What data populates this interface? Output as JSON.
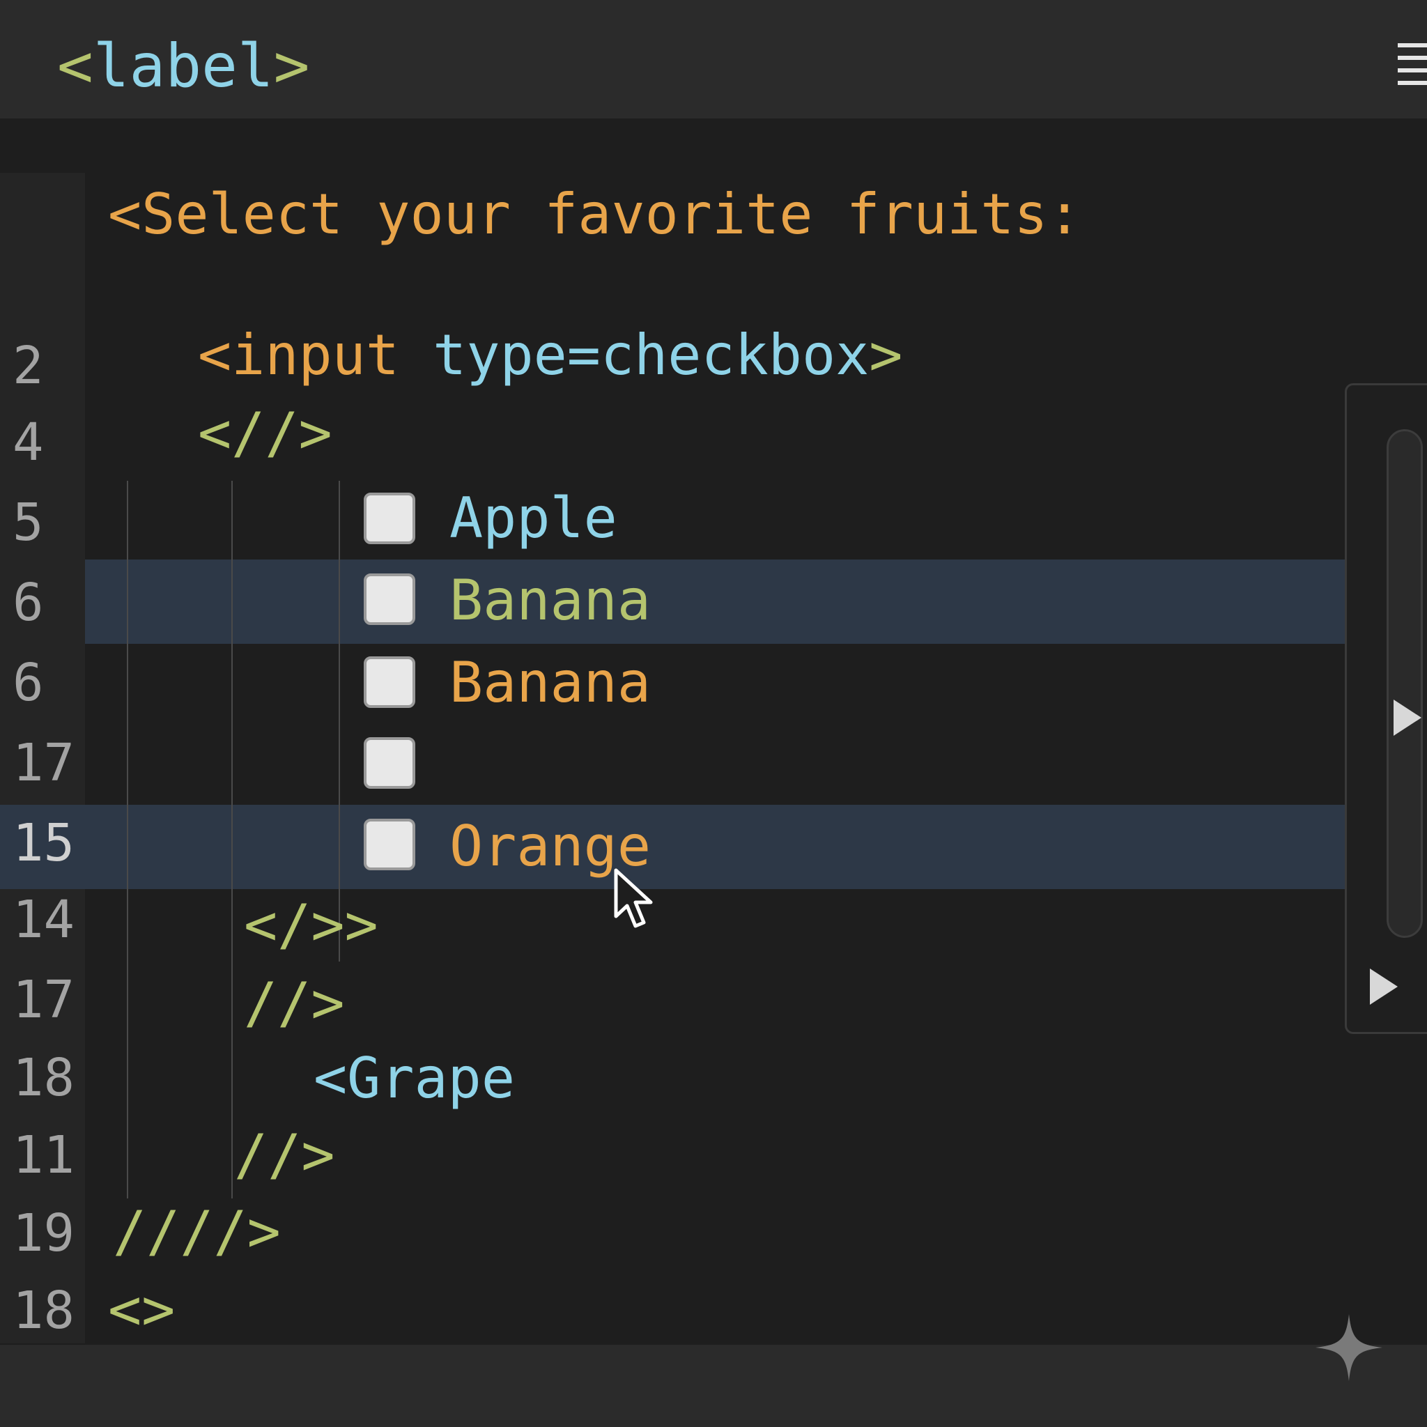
{
  "title_bar": {
    "title_open": "<",
    "title_word": "label",
    "title_close": ">",
    "menu_icon": "hamburger-menu-icon"
  },
  "editor": {
    "heading_line": "<Select your favorite fruits:",
    "lines": [
      {
        "num": "2",
        "parts": [
          "<input",
          " type=checkbox",
          ">"
        ]
      },
      {
        "num": "4",
        "text": "<//>"
      },
      {
        "num": "5",
        "label": "Apple",
        "checked": false
      },
      {
        "num": "6",
        "label": "Banana",
        "checked": false
      },
      {
        "num": "6",
        "label": "Banana",
        "checked": false
      },
      {
        "num": "17",
        "label": "",
        "checked": false
      },
      {
        "num": "15",
        "label": "Orange",
        "checked": false
      },
      {
        "num": "14",
        "text": "</>>"
      },
      {
        "num": "17",
        "text": "//>"
      },
      {
        "num": "18",
        "text": "<Grape"
      },
      {
        "num": "11",
        "text": "//>"
      },
      {
        "num": "19",
        "text": "////>"
      },
      {
        "num": "18",
        "text": "<>"
      }
    ]
  },
  "side_panel": {
    "arrow_icons": [
      "play-arrow-icon",
      "play-arrow-icon"
    ]
  },
  "colors": {
    "background": "#1e1e1e",
    "orange": "#e8a44a",
    "cyan": "#8fd3e8",
    "green": "#b5c46e",
    "highlight": "#2d3847"
  }
}
